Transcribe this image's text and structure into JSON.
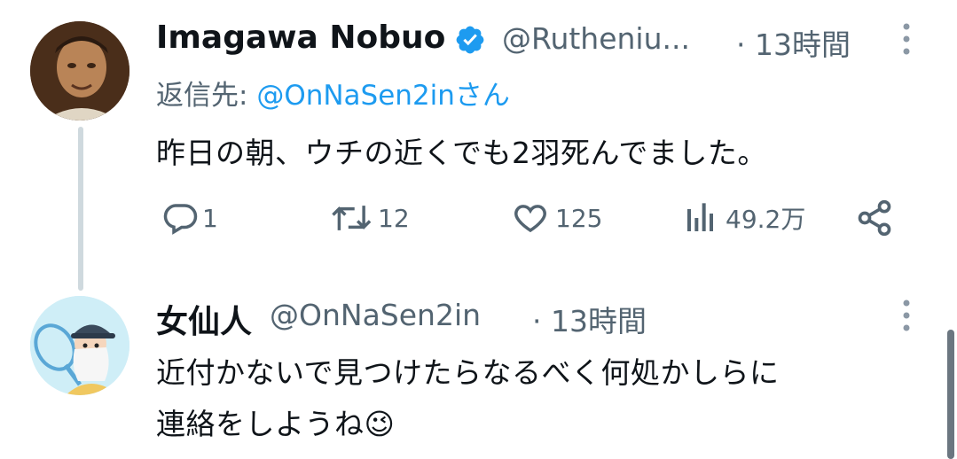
{
  "tweet": {
    "author_name": "Imagawa Nobuo",
    "verified_icon": "verified-badge-icon",
    "author_handle": "@Rutheniu...",
    "timestamp": "· 13時間",
    "reply_prefix": "返信先: ",
    "reply_to": "@OnNaSen2inさん",
    "text": "昨日の朝、ウチの近くでも2羽死んでました。",
    "actions": {
      "replies": "1",
      "retweets": "12",
      "likes": "125",
      "views": "49.2万"
    }
  },
  "reply": {
    "author_name": "女仙人",
    "author_handle": "@OnNaSen2in",
    "timestamp": "· 13時間",
    "text_line1": "近付かないで見つけたらなるべく何処かしらに",
    "text_line2": "連絡をしようね",
    "emoji": "😉"
  },
  "colors": {
    "link": "#1d9bf0",
    "secondary": "#536471",
    "thread_line": "#cfd9de",
    "verified": "#1d9bf0"
  }
}
